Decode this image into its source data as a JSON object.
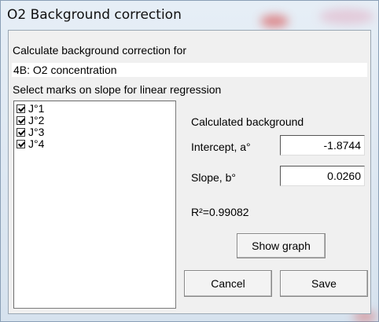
{
  "window": {
    "title": "O2 Background correction"
  },
  "dialog": {
    "calc_label": "Calculate background correction for",
    "calc_target": "4B: O2 concentration",
    "select_label": "Select marks on slope for linear regression",
    "marks": [
      {
        "label": "J°1",
        "checked": true
      },
      {
        "label": "J°2",
        "checked": true
      },
      {
        "label": "J°3",
        "checked": true
      },
      {
        "label": "J°4",
        "checked": true
      }
    ],
    "calculated_heading": "Calculated background",
    "intercept_label": "Intercept, a°",
    "intercept_value": "-1.8744",
    "slope_label": "Slope, b°",
    "slope_value": "0.0260",
    "r_squared": "R²=0.99082",
    "show_graph_label": "Show graph",
    "cancel_label": "Cancel",
    "save_label": "Save"
  }
}
